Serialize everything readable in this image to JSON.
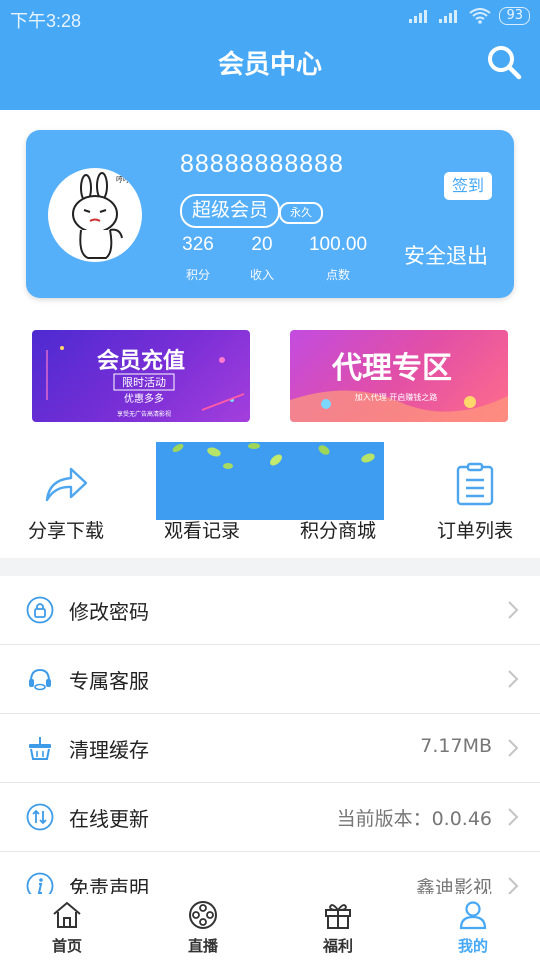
{
  "status_bar": {
    "time": "下午3:28",
    "battery": "93"
  },
  "header": {
    "title": "会员中心"
  },
  "member": {
    "user_id": "88888888888",
    "vip_label": "超级会员",
    "vip_duration": "永久",
    "sign_in_label": "签到",
    "stats": [
      {
        "value": "326",
        "label": "积分"
      },
      {
        "value": "20",
        "label": "收入"
      },
      {
        "value": "100.00",
        "label": "点数"
      }
    ],
    "logout_label": "安全退出"
  },
  "banners": {
    "left": {
      "title": "会员充值",
      "line1": "限时活动",
      "line2": "优惠多多",
      "footer": "享受无广告高清影视"
    },
    "right": {
      "title": "代理专区",
      "subtitle": "加入代理  开启赚钱之路"
    }
  },
  "quick_actions": [
    {
      "label": "分享下载",
      "icon": "share-arrow-icon"
    },
    {
      "label": "观看记录",
      "icon": "history-icon"
    },
    {
      "label": "积分商城",
      "icon": "mall-icon"
    },
    {
      "label": "订单列表",
      "icon": "clipboard-icon"
    }
  ],
  "menu": [
    {
      "label": "修改密码",
      "value": "",
      "icon": "lock-icon"
    },
    {
      "label": "专属客服",
      "value": "",
      "icon": "headset-icon"
    },
    {
      "label": "清理缓存",
      "value": "7.17MB",
      "icon": "basket-icon"
    },
    {
      "label": "在线更新",
      "value": "当前版本：0.0.46",
      "icon": "update-icon"
    },
    {
      "label": "免责声明",
      "value": "鑫迪影视",
      "icon": "info-icon"
    }
  ],
  "tabs": [
    {
      "label": "首页",
      "icon": "home-icon",
      "active": false
    },
    {
      "label": "直播",
      "icon": "film-reel-icon",
      "active": false
    },
    {
      "label": "福利",
      "icon": "gift-icon",
      "active": false
    },
    {
      "label": "我的",
      "icon": "user-icon",
      "active": true
    }
  ],
  "colors": {
    "primary": "#47a8f5",
    "text": "#222222",
    "muted": "#777777",
    "tab_inactive": "#333333"
  }
}
